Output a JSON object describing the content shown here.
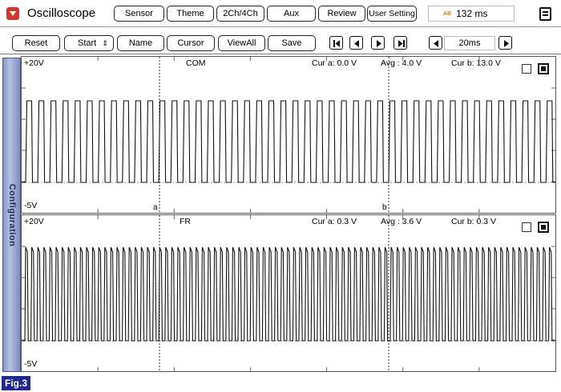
{
  "app": {
    "title": "Oscilloscope"
  },
  "top_tabs": [
    "Sensor",
    "Theme",
    "2Ch/4Ch",
    "Aux",
    "Review",
    "User Setting"
  ],
  "acquisition_time": {
    "icon_text": "AB",
    "value": "132 ms"
  },
  "toolbar": {
    "reset": "Reset",
    "start": "Start",
    "name": "Name",
    "cursor": "Cursor",
    "viewall": "ViewAll",
    "save": "Save"
  },
  "zoom": {
    "value": "20ms"
  },
  "sidebar": {
    "label": "Configuration"
  },
  "channels": [
    {
      "name": "COM",
      "vmax": "+20V",
      "vmin": "-5V",
      "cur_a": "Cur a: 0.0 V",
      "avg": "Avg  : 4.0 V",
      "cur_b": "Cur b: 13.0 V",
      "marker_a": "a",
      "marker_b": "b"
    },
    {
      "name": "FR",
      "vmax": "+20V",
      "vmin": "-5V",
      "cur_a": "Cur a: 0.3 V",
      "avg": "Avg  : 3.6 V",
      "cur_b": "Cur b: 0.3 V"
    }
  ],
  "figure_label": "Fig.3",
  "colors": {
    "sidebar": "#9aa8d4",
    "figure_badge": "#1f2a8c",
    "app_icon": "#d0382b"
  }
}
